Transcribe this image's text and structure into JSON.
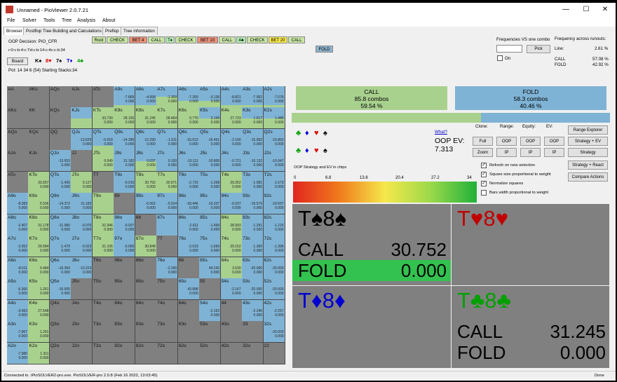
{
  "window": {
    "title": "Unnamed - PioViewer 2.0.7.21",
    "minimize": "—",
    "maximize": "☐",
    "close": "✕"
  },
  "menu": [
    "File",
    "Solver",
    "Tools",
    "Tree",
    "Analysis",
    "About"
  ],
  "tabs": [
    "Browser",
    "Postflop Tree Building and Calculations",
    "Preflop",
    "Tree information"
  ],
  "info": {
    "decision": "OOP Decision:  PIO_CFR",
    "line": "r:0:c:b:4:c:Td:c:b:14:c:4c:c:b:34",
    "board_label": "Board",
    "board_cards": [
      {
        "rank": "K",
        "suit": "♠",
        "color": "#000000"
      },
      {
        "rank": "8",
        "suit": "♥",
        "color": "#e00000"
      },
      {
        "rank": "7",
        "suit": "♠",
        "color": "#000000"
      },
      {
        "rank": "T",
        "suit": "♦",
        "color": "#0000e0"
      },
      {
        "rank": "4",
        "suit": "♣",
        "color": "#00a000"
      }
    ],
    "pot": "Pot: 14 34 6 (54) Starting Stacks:34"
  },
  "tree_nodes": [
    {
      "label": "Root",
      "color": "#c9e6a7"
    },
    {
      "label": "CHECK",
      "color": "#c9e6a7"
    },
    {
      "label": "BET 4",
      "color": "#e8907a"
    },
    {
      "label": "CALL",
      "color": "#c9e6a7"
    },
    {
      "label": "T♦",
      "color": "#b0e8b0"
    },
    {
      "label": "CHECK",
      "color": "#c9e6a7"
    },
    {
      "label": "BET 10",
      "color": "#e8907a"
    },
    {
      "label": "CALL",
      "color": "#c9e6a7"
    },
    {
      "label": "4♣",
      "color": "#b0e8b0"
    },
    {
      "label": "CHECK",
      "color": "#c9e6a7"
    },
    {
      "label": "BET 20",
      "color": "#f5e84b"
    },
    {
      "label": "CALL",
      "color": "#c9e6a7"
    }
  ],
  "tree_sub_node": {
    "label": "FOLD",
    "color": "#8fb3cc"
  },
  "frequencies": {
    "title": "Frequencies VS one combo",
    "pick_label": "Pick",
    "on_label": "On",
    "runouts_title": "Frequency across runouts:",
    "line_label": "Line:",
    "line_value": "2.61 %",
    "call_label": "CALL",
    "call_value": "57.08 %",
    "fold_label": "FOLD",
    "fold_value": "42.92 %"
  },
  "summary": {
    "call": {
      "title": "CALL",
      "combos": "85.8 combos",
      "pct": "59.54 %"
    },
    "fold": {
      "title": "FOLD",
      "combos": "58.3 combos",
      "pct": "40.46 %"
    }
  },
  "freq_bar_call_fraction": 0.5954,
  "suit_filter": {
    "row1": [
      {
        "s": "♣",
        "c": "#00a000"
      },
      {
        "s": "♦",
        "c": "#0000e0"
      },
      {
        "s": "♥",
        "c": "#e00000"
      },
      {
        "s": "♠",
        "c": "#000000"
      }
    ],
    "row2": [
      {
        "s": "♣",
        "c": "#00a000"
      },
      {
        "s": "♦",
        "c": "#0000e0"
      },
      {
        "s": "♥",
        "c": "#e00000"
      },
      {
        "s": "♠",
        "c": "#000000"
      }
    ]
  },
  "ev_info": {
    "what": "What?",
    "label": "OOP EV:",
    "value": "7.313"
  },
  "view_controls": {
    "clone": "Clone:",
    "range": "Range:",
    "equity": "Equity:",
    "ev": "EV:",
    "full": "Full",
    "zoom": "Zoom",
    "oop": "OOP",
    "ip": "IP"
  },
  "right_buttons": [
    "Range Explorer",
    "Strategy + EV",
    "Strategy",
    "Strategy + React",
    "Compare Actions"
  ],
  "checkboxes": [
    {
      "label": "Refresh on new selection",
      "checked": true
    },
    {
      "label": "Square size proportional to weight",
      "checked": true
    },
    {
      "label": "Normalize squares",
      "checked": true
    },
    {
      "label": "Bars width proportional to weight",
      "checked": false
    }
  ],
  "scale": {
    "title": "OOP Strategy and EV in chips",
    "ticks": [
      "0",
      "6.8",
      "13.6",
      "20.4",
      "27.2",
      "34"
    ]
  },
  "quadrants": [
    {
      "hand": "T♠8♠",
      "color": "#000000",
      "call_value": "30.752",
      "fold_value": "0.000"
    },
    {
      "hand": "T♥8♥",
      "color": "#c00000"
    },
    {
      "hand": "T♦8♦",
      "color": "#0000d0"
    },
    {
      "hand": "T♣8♣",
      "color": "#00a000",
      "call_value": "31.245",
      "fold_value": "0.000"
    }
  ],
  "action_labels": {
    "call": "CALL",
    "fold": "FOLD"
  },
  "grid": {
    "ranks": [
      "A",
      "K",
      "Q",
      "J",
      "T",
      "9",
      "8",
      "7",
      "6",
      "5",
      "4",
      "3",
      "2"
    ],
    "call_color": "#a9d18e",
    "fold_color": "#7fb3d5",
    "cells": {
      "AKs": {
        "v": [
          "",
          ""
        ]
      },
      "AQs": {
        "v": [
          "",
          ""
        ]
      },
      "AJs": {
        "v": [
          "",
          ""
        ]
      },
      "ATs": {
        "v": [
          "",
          ""
        ]
      },
      "A9s": {
        "call": 0.1,
        "v": [
          "-7.869",
          "0.000"
        ]
      },
      "A8s": {
        "call": 0.1,
        "v": [
          "-4.958",
          "0.000"
        ]
      },
      "A7s": {
        "call": 0.5,
        "v": [
          "-1.309",
          "0.000"
        ]
      },
      "A6s": {
        "call": 0.3,
        "v": [
          "-7.269",
          "0.000"
        ]
      },
      "A5s": {
        "call": 0.3,
        "v": [
          "-3.136",
          "0.000"
        ]
      },
      "A4s": {
        "call": 0.1,
        "v": [
          "-8.821",
          "0.000"
        ]
      },
      "A3s": {
        "call": 0.1,
        "v": [
          "-7.062",
          "0.000"
        ]
      },
      "A2s": {
        "call": 0.1,
        "v": [
          "-7.076",
          "0.000"
        ]
      },
      "KJs": {
        "call": 0.5,
        "v": [
          "",
          ""
        ]
      },
      "KTs": {
        "call": 1,
        "v": [
          "33.730",
          "0.000"
        ]
      },
      "K9s": {
        "call": 1,
        "v": [
          "28.155",
          "0.000"
        ]
      },
      "K8s": {
        "call": 1,
        "v": [
          "31.245",
          "0.000"
        ]
      },
      "K7s": {
        "call": 1,
        "v": [
          "28.464",
          "0.000"
        ]
      },
      "K6s": {
        "call": 1,
        "v": [
          "0.770",
          "0.000"
        ]
      },
      "K5s": {
        "call": 0.5,
        "v": [
          "3.169",
          "0.000"
        ]
      },
      "K4s": {
        "call": 1,
        "v": [
          "27.723",
          "0.000"
        ]
      },
      "K3s": {
        "call": 0.5,
        "v": [
          "1.517",
          "0.000"
        ]
      },
      "K2s": {
        "call": 0.5,
        "v": [
          "1.486",
          "0.000"
        ]
      },
      "QJs": {
        "call": 0,
        "v": [
          "-13.629",
          "0.000"
        ]
      },
      "QTs": {
        "call": 0.2,
        "v": [
          "-0.018",
          "0.000"
        ]
      },
      "Q9s": {
        "call": 0,
        "v": [
          "-14.390",
          "0.000"
        ]
      },
      "Q8s": {
        "call": 0,
        "v": [
          "-12.290",
          "0.000"
        ]
      },
      "Q7s": {
        "call": 0,
        "v": [
          "-1.511",
          "0.000"
        ]
      },
      "Q6s": {
        "call": 0,
        "v": [
          "-16.012",
          "0.000"
        ]
      },
      "Q5s": {
        "call": 0,
        "v": [
          "-16.461",
          "0.000"
        ]
      },
      "Q4s": {
        "call": 0,
        "v": [
          "-2.190",
          "0.000"
        ]
      },
      "Q3s": {
        "call": 0,
        "v": [
          "-15.952",
          "0.000"
        ]
      },
      "Q2s": {
        "call": 0,
        "v": [
          "-15.862",
          "0.000"
        ]
      },
      "KQo": {
        "v": [
          "",
          ""
        ]
      },
      "KJo": {
        "v": [
          "",
          ""
        ]
      },
      "QJo": {
        "call": 0,
        "v": [
          "-13.653",
          "0.000"
        ]
      },
      "JTs": {
        "call": 1,
        "v": [
          "0.049",
          "0.000"
        ]
      },
      "J9s": {
        "call": 0,
        "v": [
          "31.182",
          "0.000"
        ]
      },
      "J8s": {
        "call": 0.5,
        "v": [
          "0.037",
          "0.000"
        ]
      },
      "J7s": {
        "call": 0,
        "v": [
          "0.193",
          "0.000"
        ]
      },
      "J6s": {
        "call": 0,
        "v": [
          "-10.111",
          "0.000"
        ]
      },
      "J5s": {
        "call": 0,
        "v": [
          "-10.800",
          "0.000"
        ]
      },
      "J4s": {
        "call": 0,
        "v": [
          "-0.721",
          "0.000"
        ]
      },
      "J3s": {
        "call": 0,
        "v": [
          "-10.132",
          "0.000"
        ]
      },
      "J2s": {
        "call": 0,
        "v": [
          "-10.047",
          "0.000"
        ]
      },
      "KTo": {
        "call": 1,
        "v": [
          "33.657",
          "0.000"
        ]
      },
      "QTo": {
        "call": 0,
        "v": [
          "-1.426",
          "0.000"
        ]
      },
      "JTo": {
        "call": 1,
        "v": [
          "0.127",
          "0.000"
        ]
      },
      "T9s": {
        "call": 0,
        "v": [
          "-0.015",
          "0.000"
        ]
      },
      "T8s": {
        "call": 1,
        "v": [
          "30.752",
          "0.000"
        ]
      },
      "T7s": {
        "call": 1,
        "v": [
          "30.971",
          "0.000"
        ]
      },
      "T6s": {
        "call": 0,
        "v": [
          "-2.715",
          "0.000"
        ]
      },
      "T5s": {
        "call": 0,
        "v": [
          "-1.268",
          "0.000"
        ]
      },
      "T4s": {
        "call": 1,
        "v": [
          "29.252",
          "0.000"
        ]
      },
      "T3s": {
        "call": 0,
        "v": [
          "-1.581",
          "0.000"
        ]
      },
      "T2s": {
        "call": 0,
        "v": [
          "-1.573",
          "0.000"
        ]
      },
      "A9o": {
        "call": 0,
        "v": [
          "-8.083",
          "0.000"
        ]
      },
      "K9o": {
        "call": 1,
        "v": [
          "5.536",
          "0.000"
        ]
      },
      "Q9o": {
        "call": 0,
        "v": [
          "-14.372",
          "0.000"
        ]
      },
      "J9o": {
        "call": 0,
        "v": [
          "31.182",
          "0.000"
        ]
      },
      "T9o": {
        "call": 1,
        "v": [
          "",
          ""
        ]
      },
      "98s": {
        "call": 0,
        "v": [
          "-0.062",
          "0.000"
        ]
      },
      "97s": {
        "call": 0,
        "v": [
          "-0.014",
          "0.000"
        ]
      },
      "96s": {
        "call": 0,
        "v": [
          "-18.446",
          "0.000"
        ]
      },
      "95s": {
        "call": 0,
        "v": [
          "-19.337",
          "0.000"
        ]
      },
      "94s": {
        "call": 0,
        "v": [
          "-0.037",
          "0.000"
        ]
      },
      "93s": {
        "call": 0,
        "v": [
          "-19.579",
          "0.000"
        ]
      },
      "92s": {
        "call": 0,
        "v": [
          "-19.597",
          "0.000"
        ]
      },
      "A8o": {
        "call": 0,
        "v": [
          "-2.407",
          "0.000"
        ]
      },
      "K8o": {
        "call": 1,
        "v": [
          "31.178",
          "0.000"
        ]
      },
      "Q8o": {
        "call": 0,
        "v": [
          "-11.980",
          "0.000"
        ]
      },
      "J8o": {
        "call": 0,
        "v": [
          "-0.076",
          "0.000"
        ]
      },
      "T8o": {
        "call": 1,
        "v": [
          "31.946",
          "0.000"
        ]
      },
      "98o": {
        "call": 0,
        "v": [
          "-0.037",
          "0.000"
        ]
      },
      "87s": {
        "call": 0,
        "v": [
          "",
          ""
        ]
      },
      "86s": {
        "call": 0,
        "v": [
          "-2.611",
          "0.000"
        ]
      },
      "85s": {
        "call": 0,
        "v": [
          "-1.469",
          "0.000"
        ]
      },
      "84s": {
        "call": 1,
        "v": [
          "28.993",
          "0.000"
        ]
      },
      "83s": {
        "call": 0,
        "v": [
          "-1.291",
          "0.000"
        ]
      },
      "82s": {
        "call": 0,
        "v": [
          "-1.215",
          "0.000"
        ]
      },
      "A7o": {
        "call": 0,
        "v": [
          "-2.052",
          "0.000"
        ]
      },
      "K7o": {
        "call": 1,
        "v": [
          "29.584",
          "0.000"
        ]
      },
      "Q7o": {
        "call": 0,
        "v": [
          "-1.479",
          "0.000"
        ]
      },
      "J7o": {
        "call": 0,
        "v": [
          "-0.023",
          "0.000"
        ]
      },
      "T7o": {
        "call": 1,
        "v": [
          "31.105",
          "0.000"
        ]
      },
      "97o": {
        "call": 0,
        "v": [
          "-0.060",
          "0.000"
        ]
      },
      "87o": {
        "call": 1,
        "v": [
          "30.848",
          "0.000"
        ]
      },
      "76s": {
        "call": 0,
        "v": [
          "-2.019",
          "0.000"
        ]
      },
      "75s": {
        "call": 0,
        "v": [
          "-1.669",
          "0.000"
        ]
      },
      "74s": {
        "call": 1,
        "v": [
          "29.152",
          "0.000"
        ]
      },
      "73s": {
        "call": 0,
        "v": [
          "-1.360",
          "0.000"
        ]
      },
      "72s": {
        "call": 0,
        "v": [
          "-1.396",
          "0.000"
        ]
      },
      "A6o": {
        "call": 0,
        "v": [
          "-8.611",
          "0.000"
        ]
      },
      "K6o": {
        "call": 1,
        "v": [
          "0.484",
          "0.000"
        ]
      },
      "Q6o": {
        "call": 0,
        "v": [
          "-16.364",
          "0.000"
        ]
      },
      "J6o": {
        "call": 0,
        "v": [
          "-10.223",
          "0.000"
        ]
      },
      "76o": {
        "call": 0,
        "v": [
          "-2.290",
          "0.000"
        ]
      },
      "65s": {
        "call": 0,
        "v": [
          "44.242",
          "0.000"
        ]
      },
      "64s": {
        "call": 1,
        "v": [
          "3.530",
          "0.000"
        ]
      },
      "63s": {
        "call": 0,
        "v": [
          "-20.000",
          "0.000"
        ]
      },
      "62s": {
        "call": 0,
        "v": [
          "-20.000",
          "0.000"
        ]
      },
      "A5o": {
        "call": 0,
        "v": [
          "-6.366",
          "0.000"
        ]
      },
      "K5o": {
        "call": 1,
        "v": [
          "1.261",
          "0.000"
        ]
      },
      "Q5o": {
        "call": 0,
        "v": [
          "-16.505",
          "0.000"
        ]
      },
      "65o": {
        "call": 0,
        "v": [
          "43.898",
          "0.000"
        ]
      },
      "54s": {
        "call": 0,
        "v": [
          "-2.167",
          "0.000"
        ]
      },
      "53s": {
        "call": 0,
        "v": [
          "-20.000",
          "0.000"
        ]
      },
      "52s": {
        "call": 0,
        "v": [
          "-20.000",
          "0.000"
        ]
      },
      "A4o": {
        "call": 0,
        "v": [
          "-3.063",
          "0.000"
        ]
      },
      "K4o": {
        "call": 1,
        "v": [
          "27.548",
          "0.000"
        ]
      },
      "54o": {
        "call": 0,
        "v": [
          "-2.162",
          "0.000"
        ]
      },
      "43s": {
        "call": 0,
        "v": [
          "-2.246",
          "0.000"
        ]
      },
      "42s": {
        "call": 0,
        "v": [
          "-2.257",
          "0.000"
        ]
      },
      "A3o": {
        "call": 0,
        "v": [
          "-7.967",
          "0.000"
        ]
      },
      "K3o": {
        "call": 1,
        "v": [
          "1.291",
          "0.000"
        ]
      },
      "32s": {
        "call": 0,
        "v": [
          "-20.000",
          "0.000"
        ]
      },
      "A2o": {
        "call": 0,
        "v": [
          "-7.980",
          "0.000"
        ]
      },
      "K2o": {
        "call": 1,
        "v": [
          "1.311",
          "0.000"
        ]
      }
    }
  },
  "status": {
    "left": "Connected to .\\PioSOLVER2-pro.exe. PioSOLVER-pro 2.0.8 (Feb 16 2022, 13:03:45)",
    "right": "Done"
  }
}
